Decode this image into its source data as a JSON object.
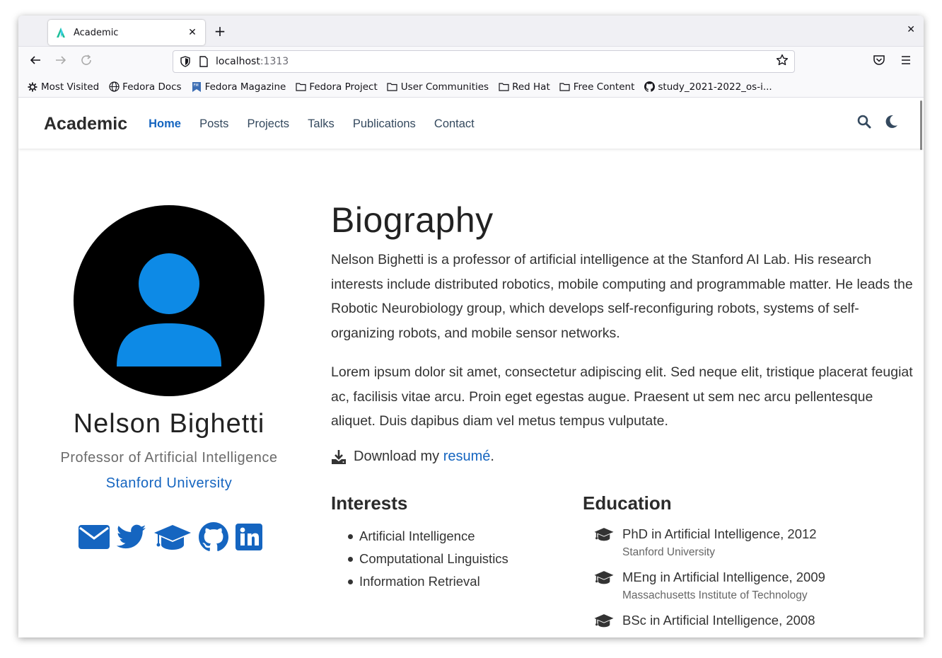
{
  "browser": {
    "tab_title": "Academic",
    "url_host": "localhost",
    "url_port": ":1313",
    "bookmarks": [
      "Most Visited",
      "Fedora Docs",
      "Fedora Magazine",
      "Fedora Project",
      "User Communities",
      "Red Hat",
      "Free Content",
      "study_2021-2022_os-i..."
    ]
  },
  "site": {
    "brand": "Academic",
    "menu": [
      "Home",
      "Posts",
      "Projects",
      "Talks",
      "Publications",
      "Contact"
    ],
    "active_menu": "Home"
  },
  "profile": {
    "name": "Nelson Bighetti",
    "role": "Professor of Artificial Intelligence",
    "organization": "Stanford University",
    "social_icons": [
      "envelope-icon",
      "twitter-icon",
      "graduation-cap-icon",
      "github-icon",
      "linkedin-icon"
    ]
  },
  "biography": {
    "title": "Biography",
    "p1": "Nelson Bighetti is a professor of artificial intelligence at the Stanford AI Lab. His research interests include distributed robotics, mobile computing and programmable matter. He leads the Robotic Neurobiology group, which develops self-reconfiguring robots, systems of self-organizing robots, and mobile sensor networks.",
    "p2": "Lorem ipsum dolor sit amet, consectetur adipiscing elit. Sed neque elit, tristique placerat feugiat ac, facilisis vitae arcu. Proin eget egestas augue. Praesent ut sem nec arcu pellentesque aliquet. Duis dapibus diam vel metus tempus vulputate.",
    "resume_prefix": "Download my ",
    "resume_link": "resumé",
    "resume_suffix": "."
  },
  "interests": {
    "title": "Interests",
    "items": [
      "Artificial Intelligence",
      "Computational Linguistics",
      "Information Retrieval"
    ]
  },
  "education": {
    "title": "Education",
    "items": [
      {
        "degree": "PhD in Artificial Intelligence, 2012",
        "institution": "Stanford University"
      },
      {
        "degree": "MEng in Artificial Intelligence, 2009",
        "institution": "Massachusetts Institute of Technology"
      },
      {
        "degree": "BSc in Artificial Intelligence, 2008",
        "institution": ""
      }
    ]
  },
  "colors": {
    "accent": "#1565c0",
    "avatar_figure": "#0d8ae6"
  }
}
